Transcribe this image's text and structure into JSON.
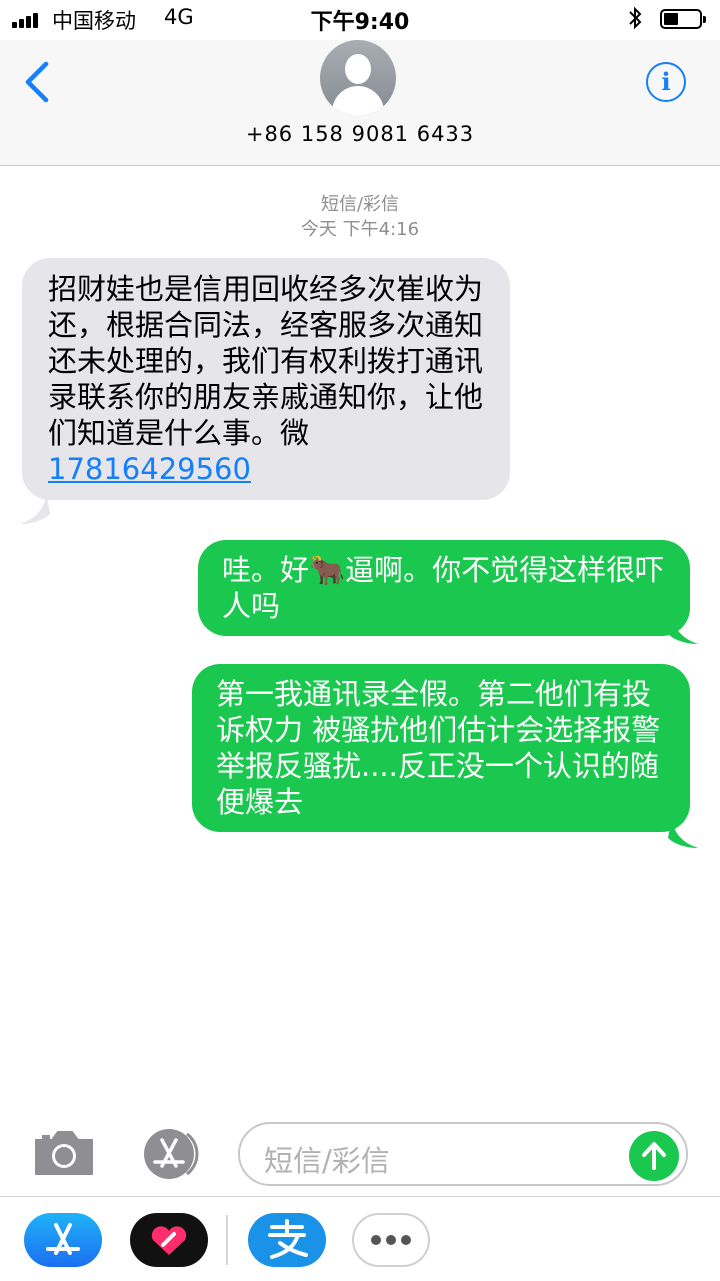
{
  "status_bar": {
    "carrier": "中国移动",
    "network": "4G",
    "time": "下午9:40"
  },
  "header": {
    "contact_number": "+86 158 9081 6433",
    "icons": [
      "back-chevron-icon",
      "avatar-icon",
      "info-icon"
    ]
  },
  "conversation": {
    "service_label": "短信/彩信",
    "timestamp": "今天 下午4:16",
    "messages": [
      {
        "direction": "incoming",
        "text": "招财娃也是信用回收经多次崔收为还，根据合同法，经客服多次通知还未处理的，我们有权利拨打通讯录联系你的朋友亲戚通知你，让他们知道是什么事。微",
        "link": "17816429560"
      },
      {
        "direction": "outgoing",
        "text_before": "哇。好",
        "emoji": "🐂",
        "text_after": "逼啊。你不觉得这样很吓人吗"
      },
      {
        "direction": "outgoing",
        "text": "第一我通讯录全假。第二他们有投诉权力 被骚扰他们估计会选择报警 举报反骚扰....反正没一个认识的随便爆去"
      }
    ]
  },
  "composer": {
    "placeholder": "短信/彩信",
    "icons": [
      "camera-icon",
      "app-store-icon",
      "send-arrow-icon"
    ]
  },
  "app_drawer": {
    "apps": [
      "app-store-app-icon",
      "digital-touch-app-icon",
      "alipay-app-icon",
      "more-apps-icon"
    ]
  },
  "colors": {
    "outgoing_bubble": "#1bc84f",
    "incoming_bubble": "#e5e5ea",
    "ios_blue": "#147efb",
    "meta_gray": "#8e8e93"
  }
}
